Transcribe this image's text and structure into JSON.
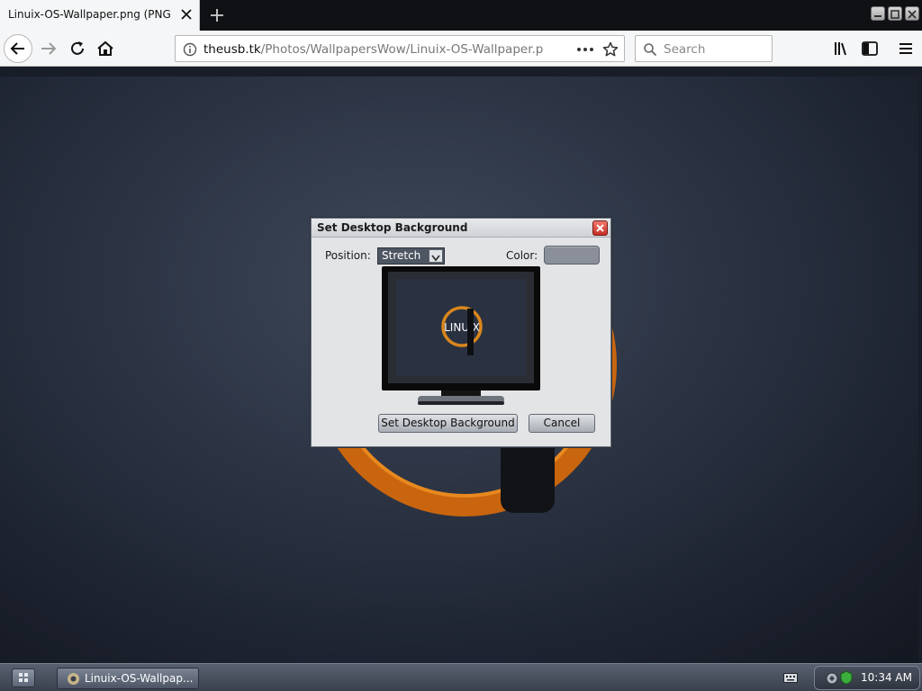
{
  "browser": {
    "tab_title": "Linuix-OS-Wallpaper.png (PNG I",
    "url_host": "theusb.tk",
    "url_path": "/Photos/WallpapersWow/Linuix-OS-Wallpaper.p",
    "search_placeholder": "Search"
  },
  "dialog": {
    "title": "Set Desktop Background",
    "position_label": "Position:",
    "position_value": "Stretch",
    "color_label": "Color:",
    "color_value": "#8a8f99",
    "preview_logo_text": "LINUIX",
    "set_button_label": "Set Desktop Background",
    "cancel_button_label": "Cancel"
  },
  "taskbar": {
    "task_label": "Linuix-OS-Wallpap...",
    "clock": "10:34 AM"
  },
  "colors": {
    "accent_orange": "#e07a12",
    "dialog_bg": "#e2e4e6",
    "taskbar": "#4a515e"
  }
}
